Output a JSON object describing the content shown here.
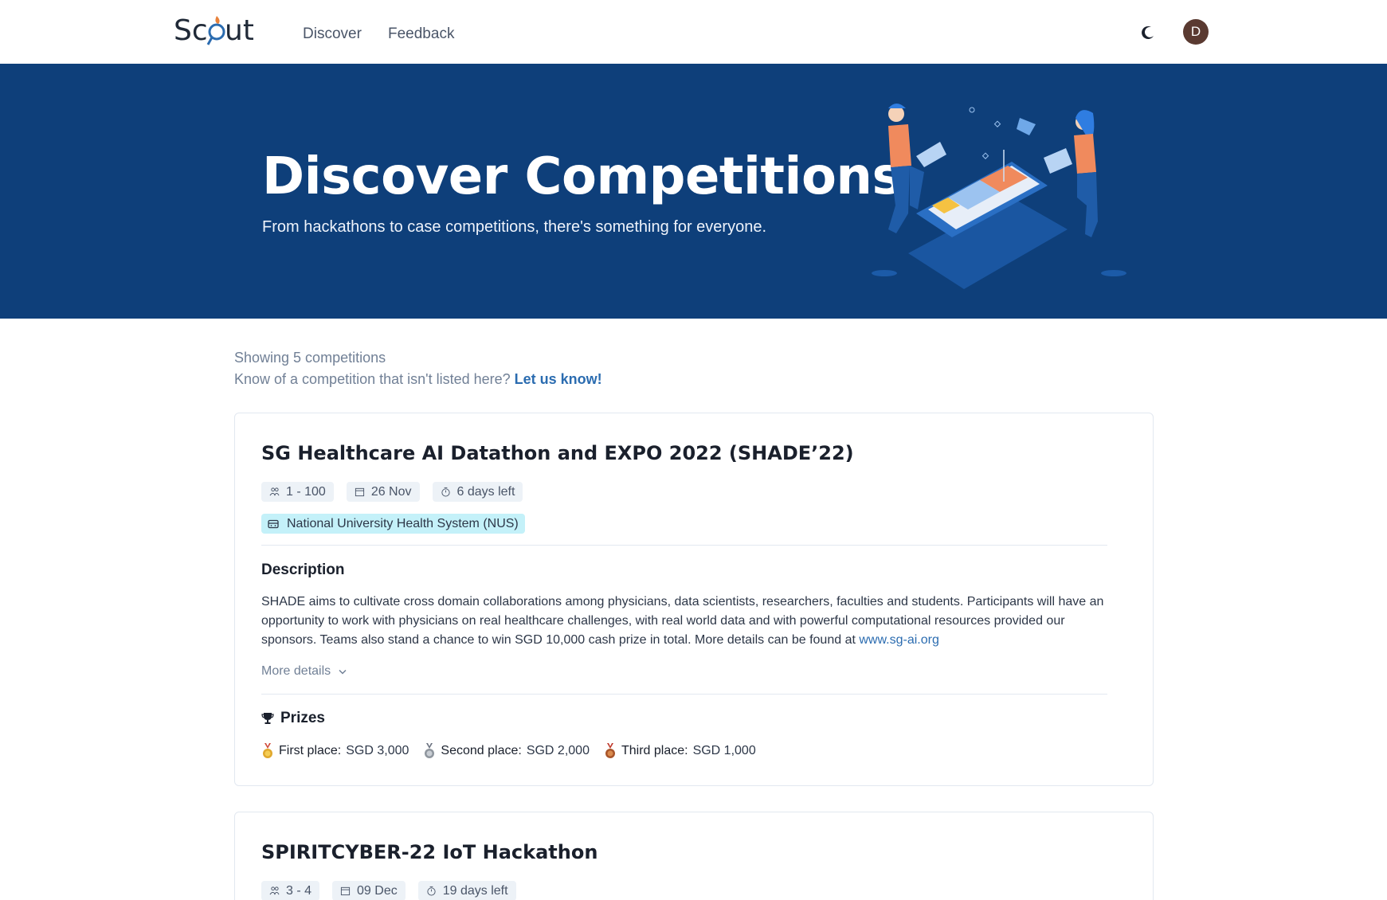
{
  "nav": {
    "logo_text": "Scout",
    "links": [
      "Discover",
      "Feedback"
    ],
    "avatar_letter": "D"
  },
  "hero": {
    "title": "Discover Competitions",
    "subtitle": "From hackathons to case competitions, there's something for everyone."
  },
  "summary": {
    "count_text": "Showing 5 competitions",
    "prompt_text": "Know of a competition that isn't listed here?",
    "link_text": "Let us know!"
  },
  "competitions": [
    {
      "title": "SG Healthcare AI Datathon and EXPO 2022 (SHADE’22)",
      "team_size": "1 - 100",
      "date": "26 Nov",
      "time_left": "6 days left",
      "organizer": "National University Health System (NUS)",
      "description_heading": "Description",
      "description": "SHADE aims to cultivate cross domain collaborations among physicians, data scientists, researchers, faculties and students. Participants will have an opportunity to work with physicians on real healthcare challenges, with real world data and with powerful computational resources provided our sponsors. Teams also stand a chance to win SGD 10,000 cash prize in total. More details can be found at",
      "description_link": "www.sg-ai.org",
      "more_details": "More details",
      "prizes_heading": "Prizes",
      "prizes": [
        {
          "label": "First place:",
          "value": "SGD 3,000",
          "color": "#d4a017"
        },
        {
          "label": "Second place:",
          "value": "SGD 2,000",
          "color": "#a0a7b0"
        },
        {
          "label": "Third place:",
          "value": "SGD 1,000",
          "color": "#b8652a"
        }
      ]
    },
    {
      "title": "SPIRITCYBER-22 IoT Hackathon",
      "team_size": "3 - 4",
      "date": "09 Dec",
      "time_left": "19 days left"
    }
  ],
  "colors": {
    "hero_bg": "#0e3f7a",
    "link": "#2b6cb0",
    "org_tag_bg": "#c4f1f9",
    "tag_bg": "#edf2f7"
  }
}
